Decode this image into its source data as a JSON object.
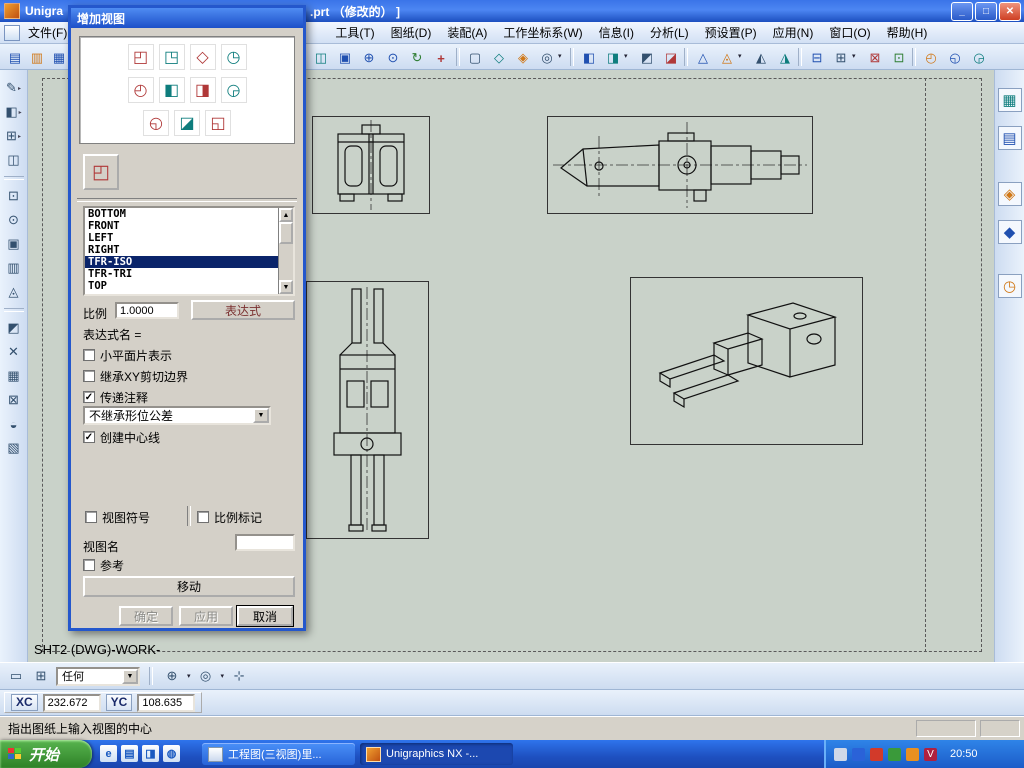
{
  "window": {
    "title_left": "Unigra",
    "title_right": ".prt （修改的） ]",
    "controls": {
      "minimize": "_",
      "maximize": "□",
      "close": "✕"
    }
  },
  "menubar": {
    "file": "文件(F)",
    "items": [
      "工具(T)",
      "图纸(D)",
      "装配(A)",
      "工作坐标系(W)",
      "信息(I)",
      "分析(L)",
      "预设置(P)",
      "应用(N)",
      "窗口(O)",
      "帮助(H)"
    ]
  },
  "toolbars": {
    "top": [
      "▤",
      "▥",
      "▦",
      "◫",
      "▣",
      "⊕",
      "⊙",
      "↻",
      "+",
      "▢",
      "◇",
      "◈",
      "◎",
      "◧",
      "◨",
      "◩",
      "◪",
      "△",
      "◬",
      "◭",
      "◮",
      "⊟",
      "⊞",
      "⊠",
      "⊡",
      "◴",
      "◵",
      "◶"
    ],
    "left": [
      "✎",
      "◧",
      "⊞",
      "◫",
      "⊡",
      "⊙",
      "▣",
      "▥",
      "◬",
      "◩",
      "✕",
      "▦",
      "⊠",
      "◒",
      "▧"
    ],
    "right": [
      "▦",
      "▤",
      "◈",
      "◆",
      "◷"
    ]
  },
  "dialog": {
    "title": "增加视图",
    "grid_icons": [
      "◰",
      "◳",
      "◇",
      "◷",
      "◴",
      "◧",
      "◨",
      "◶",
      "◵",
      "◪",
      "◱"
    ],
    "base_icon": "◰",
    "view_list": {
      "items": [
        "BOTTOM",
        "FRONT",
        "LEFT",
        "RIGHT",
        "TFR-ISO",
        "TFR-TRI",
        "TOP"
      ],
      "selected": "TFR-ISO"
    },
    "scale_label": "比例",
    "scale_value": "1.0000",
    "expression_button": "表达式",
    "expression_name_label": "表达式名 =",
    "options": [
      {
        "label": "小平面片表示",
        "checked": false
      },
      {
        "label": "继承XY剪切边界",
        "checked": false
      },
      {
        "label": "传递注释",
        "checked": true
      }
    ],
    "tolerance_dropdown": "不继承形位公差",
    "centerline": {
      "label": "创建中心线",
      "checked": true
    },
    "view_symbol": {
      "label": "视图符号",
      "checked": false
    },
    "scale_mark": {
      "label": "比例标记",
      "checked": false
    },
    "view_name_label": "视图名",
    "view_name_value": "",
    "reference": {
      "label": "参考",
      "checked": false
    },
    "move_button": "移动",
    "ok_button": "确定",
    "apply_button": "应用",
    "cancel_button": "取消"
  },
  "canvas": {
    "sheet_label": "SHT2 (DWG)-WORK-"
  },
  "selection_bar": {
    "filter_value": "任何",
    "icons_left": [
      "▭",
      "⊞"
    ],
    "icons_right": [
      "⊕",
      "◎",
      "⊹"
    ]
  },
  "coordinates": {
    "x_label": "XC",
    "x_value": "232.672",
    "y_label": "YC",
    "y_value": "108.635"
  },
  "status": {
    "message": "指出图纸上输入视图的中心"
  },
  "taskbar": {
    "start_label": "开始",
    "quick_launch": [
      "e",
      "▤",
      "◨",
      "◍"
    ],
    "tasks": [
      {
        "label": "工程图(三视图)里..."
      },
      {
        "label": "Unigraphics NX -..."
      }
    ],
    "time": "20:50"
  }
}
